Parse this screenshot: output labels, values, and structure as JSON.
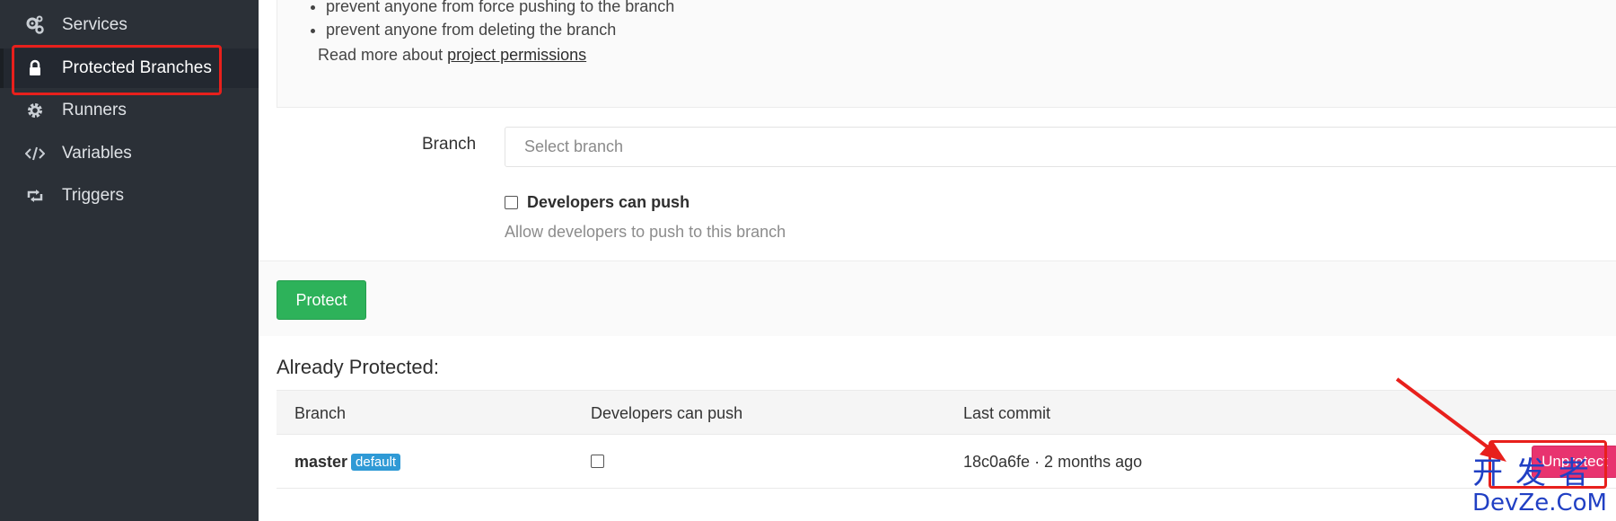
{
  "sidebar": {
    "items": [
      {
        "label": "Services",
        "icon": "gears-icon"
      },
      {
        "label": "Protected Branches",
        "icon": "lock-icon",
        "active": true
      },
      {
        "label": "Runners",
        "icon": "gear-icon"
      },
      {
        "label": "Variables",
        "icon": "code-icon"
      },
      {
        "label": "Triggers",
        "icon": "retweet-icon"
      }
    ]
  },
  "info": {
    "bullets": [
      "prevent anyone from force pushing to the branch",
      "prevent anyone from deleting the branch"
    ],
    "read_more_prefix": "Read more about ",
    "read_more_link": "project permissions"
  },
  "form": {
    "branch_label": "Branch",
    "branch_placeholder": "Select branch",
    "dev_push_label": "Developers can push",
    "dev_push_help": "Allow developers to push to this branch",
    "protect_button": "Protect"
  },
  "protected": {
    "heading": "Already Protected:",
    "columns": [
      "Branch",
      "Developers can push",
      "Last commit"
    ],
    "rows": [
      {
        "branch": "master",
        "badge": "default",
        "developers_can_push": false,
        "last_commit": "18c0a6fe · 2 months ago",
        "action": "Unprotect"
      }
    ]
  },
  "watermark": {
    "cn": "开发者",
    "en": "DevZe.CoM"
  },
  "colors": {
    "sidebar_bg": "#2b3037",
    "protect": "#2db25a",
    "unprotect": "#e8336f",
    "badge": "#2f9ad6",
    "highlight": "#e8201c"
  }
}
